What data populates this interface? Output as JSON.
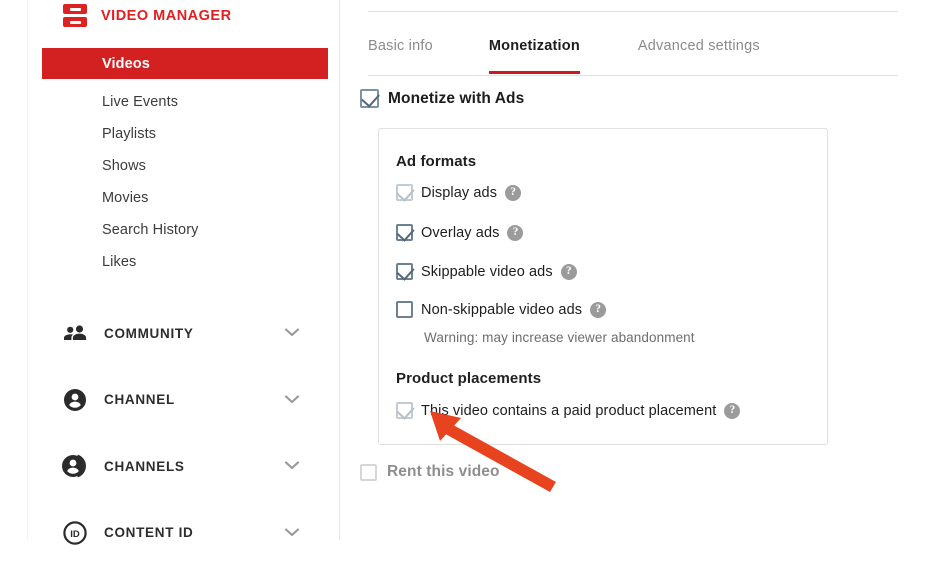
{
  "sidebar": {
    "brand": {
      "label": "VIDEO MANAGER",
      "icon": "video-manager-logo-icon",
      "color": "#e02020"
    },
    "active_item": {
      "label": "Videos",
      "background": "#d32121",
      "text_color": "#ffffff"
    },
    "items": [
      {
        "label": "Live Events"
      },
      {
        "label": "Playlists"
      },
      {
        "label": "Shows"
      },
      {
        "label": "Movies"
      },
      {
        "label": "Search History"
      },
      {
        "label": "Likes"
      }
    ],
    "sections": [
      {
        "label": "COMMUNITY",
        "icon": "people-icon",
        "chevron": "chevron-down-icon"
      },
      {
        "label": "CHANNEL",
        "icon": "person-circle-icon",
        "chevron": "chevron-down-icon"
      },
      {
        "label": "CHANNELS",
        "icon": "person-circle-stack-icon",
        "chevron": "chevron-down-icon"
      },
      {
        "label": "CONTENT ID",
        "icon": "content-id-icon",
        "chevron": "chevron-down-icon"
      }
    ]
  },
  "main": {
    "tabs": [
      {
        "label": "Basic info",
        "active": false
      },
      {
        "label": "Monetization",
        "active": true
      },
      {
        "label": "Advanced settings",
        "active": false
      }
    ],
    "active_tab_color": "#cc181e",
    "monetize": {
      "label": "Monetize with Ads",
      "checked": true
    },
    "panel": {
      "ad_formats_heading": "Ad formats",
      "ad_formats": [
        {
          "label": "Display ads",
          "checked": true,
          "dimmed": true,
          "help": "help-icon"
        },
        {
          "label": "Overlay ads",
          "checked": true,
          "dimmed": false,
          "help": "help-icon"
        },
        {
          "label": "Skippable video ads",
          "checked": true,
          "dimmed": false,
          "help": "help-icon"
        },
        {
          "label": "Non-skippable video ads",
          "checked": false,
          "dimmed": false,
          "help": "help-icon"
        }
      ],
      "warning": "Warning: may increase viewer abandonment",
      "product_heading": "Product placements",
      "product_option": {
        "label": "This video contains a paid product placement",
        "checked": true,
        "help": "help-icon"
      }
    },
    "rent": {
      "label": "Rent this video",
      "checked": false,
      "disabled": true
    }
  },
  "annotation": {
    "type": "arrow",
    "color": "#e8431f",
    "points_at": "product-placement-checkbox"
  }
}
